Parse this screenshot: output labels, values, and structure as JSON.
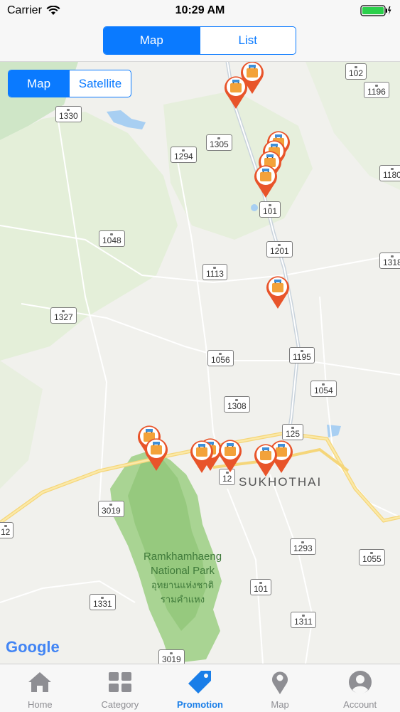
{
  "status": {
    "carrier": "Carrier",
    "time": "10:29 AM"
  },
  "top_segment": {
    "options": [
      "Map",
      "List"
    ],
    "selected": 0
  },
  "map_type_segment": {
    "options": [
      "Map",
      "Satellite"
    ],
    "selected": 0
  },
  "map": {
    "road_labels": [
      "102",
      "1196",
      "1330",
      "1305",
      "1294",
      "1180",
      "101",
      "1048",
      "1201",
      "1113",
      "1318",
      "1327",
      "1195",
      "1056",
      "1054",
      "1308",
      "125",
      "12",
      "3019",
      "1293",
      "1055",
      "101",
      "1331",
      "1311",
      "3019",
      "12"
    ],
    "city_label": "SUKHOTHAI",
    "park_label": [
      "Ramkhamhaeng",
      "National Park",
      "อุทยานแห่งชาติ",
      "รามคำแหง"
    ],
    "logo": "Google",
    "accent_color": "#e8542a"
  },
  "tabs": [
    {
      "label": "Home",
      "icon": "home-icon"
    },
    {
      "label": "Category",
      "icon": "grid-icon"
    },
    {
      "label": "Promotion",
      "icon": "tag-icon"
    },
    {
      "label": "Map",
      "icon": "map-pin-icon"
    },
    {
      "label": "Account",
      "icon": "user-icon"
    }
  ],
  "active_tab": 2
}
